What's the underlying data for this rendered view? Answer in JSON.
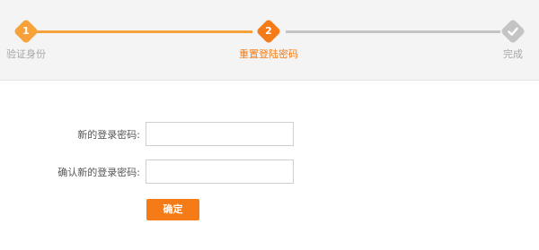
{
  "colors": {
    "accent": "#f47b16",
    "progress_done": "#f6a13a",
    "progress_todo": "#c4c4c4",
    "inactive_text": "#a7a7a7",
    "header_bg": "#f4f4f4"
  },
  "stepper": {
    "steps": [
      {
        "number": "1",
        "label": "验证身份",
        "state": "done",
        "icon": "step-number-1"
      },
      {
        "number": "2",
        "label": "重置登陆密码",
        "state": "active",
        "icon": "step-number-2"
      },
      {
        "number": "",
        "label": "完成",
        "state": "pending",
        "icon": "check-icon"
      }
    ]
  },
  "form": {
    "new_password_label": "新的登录密码:",
    "new_password_value": "",
    "confirm_password_label": "确认新的登录密码:",
    "confirm_password_value": "",
    "submit_label": "确定"
  }
}
